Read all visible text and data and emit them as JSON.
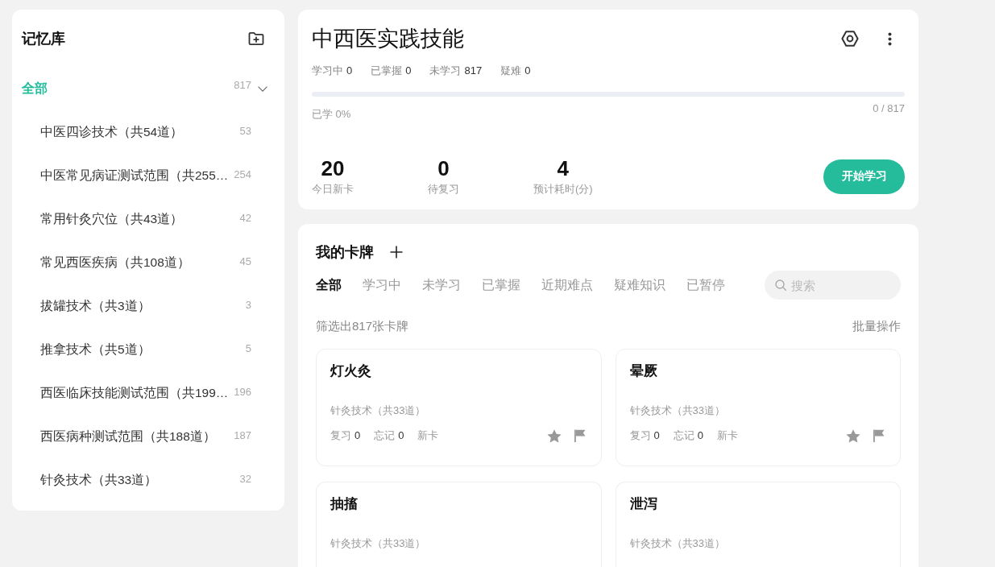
{
  "sidebar": {
    "title": "记忆库",
    "root": {
      "label": "全部",
      "count": "817",
      "selected": true,
      "expanded": true,
      "children": [
        {
          "label": "中医四诊技术（共54道）",
          "count": "53",
          "selected": false
        },
        {
          "label": "中医常见病证测试范围（共255…",
          "count": "254",
          "selected": false
        },
        {
          "label": "常用针灸穴位（共43道）",
          "count": "42",
          "selected": false
        },
        {
          "label": "常见西医疾病（共108道）",
          "count": "45",
          "selected": false
        },
        {
          "label": "拔罐技术（共3道）",
          "count": "3",
          "selected": false
        },
        {
          "label": "推拿技术（共5道）",
          "count": "5",
          "selected": false
        },
        {
          "label": "西医临床技能测试范围（共199…",
          "count": "196",
          "selected": false
        },
        {
          "label": "西医病种测试范围（共188道）",
          "count": "187",
          "selected": false
        },
        {
          "label": "针灸技术（共33道）",
          "count": "32",
          "selected": false
        }
      ]
    }
  },
  "deck": {
    "title": "中西医实践技能",
    "stats": [
      {
        "label": "学习中",
        "value": "0"
      },
      {
        "label": "已掌握",
        "value": "0"
      },
      {
        "label": "未学习",
        "value": "817"
      },
      {
        "label": "疑难",
        "value": "0"
      }
    ],
    "progress": {
      "level": 0,
      "caption": "已学 0%",
      "count": "0 / 817"
    },
    "summary": [
      {
        "value": "20",
        "label": "今日新卡"
      },
      {
        "value": "0",
        "label": "待复习"
      },
      {
        "value": "4",
        "label": "预计耗时(分)"
      }
    ],
    "start_button": "开始学习"
  },
  "cards_panel": {
    "title": "我的卡牌",
    "tabs": [
      {
        "label": "全部",
        "selected": true
      },
      {
        "label": "学习中",
        "selected": false
      },
      {
        "label": "未学习",
        "selected": false
      },
      {
        "label": "已掌握",
        "selected": false
      },
      {
        "label": "近期难点",
        "selected": false
      },
      {
        "label": "疑难知识",
        "selected": false
      },
      {
        "label": "已暂停",
        "selected": false
      }
    ],
    "search": {
      "placeholder": "搜索"
    },
    "filter_text": "筛选出817张卡牌",
    "batch_action": "批量操作",
    "cards": [
      {
        "title": "灯火灸",
        "subtitle": "针灸技术（共33道）",
        "stats": [
          {
            "label": "复习",
            "value": "0"
          },
          {
            "label": "忘记",
            "value": "0"
          },
          {
            "label": "新卡"
          }
        ]
      },
      {
        "title": "晕厥",
        "subtitle": "针灸技术（共33道）",
        "stats": [
          {
            "label": "复习",
            "value": "0"
          },
          {
            "label": "忘记",
            "value": "0"
          },
          {
            "label": "新卡"
          }
        ]
      },
      {
        "title": "抽搐",
        "subtitle": "针灸技术（共33道）"
      },
      {
        "title": "泄泻",
        "subtitle": "针灸技术（共33道）"
      }
    ]
  }
}
